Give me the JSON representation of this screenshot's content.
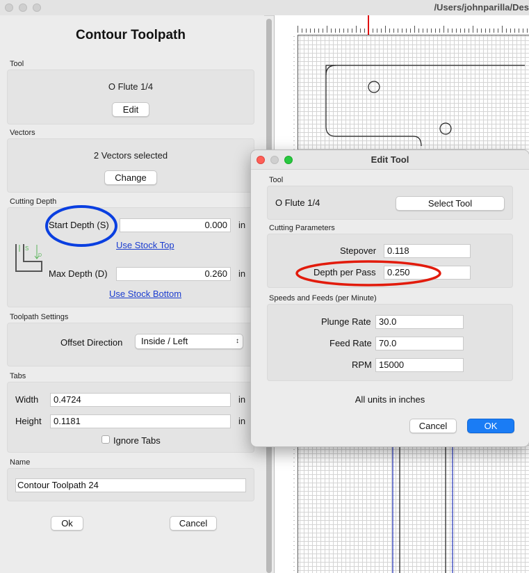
{
  "window": {
    "path": "/Users/johnparilla/Des"
  },
  "left": {
    "title": "Contour Toolpath",
    "tool": {
      "label": "Tool",
      "name": "O Flute 1/4",
      "edit_label": "Edit"
    },
    "vectors": {
      "label": "Vectors",
      "status": "2 Vectors selected",
      "change_label": "Change"
    },
    "cutting_depth": {
      "label": "Cutting Depth",
      "start_label": "Start Depth (S)",
      "start_value": "0.000",
      "start_unit": "in",
      "use_stock_top": "Use Stock Top",
      "max_label": "Max Depth (D)",
      "max_value": "0.260",
      "max_unit": "in",
      "use_stock_bottom": "Use Stock Bottom",
      "diagram_s": "S",
      "diagram_d": "D"
    },
    "toolpath_settings": {
      "label": "Toolpath Settings",
      "offset_label": "Offset Direction",
      "offset_value": "Inside / Left"
    },
    "tabs": {
      "label": "Tabs",
      "width_label": "Width",
      "width_value": "0.4724",
      "width_unit": "in",
      "height_label": "Height",
      "height_value": "0.1181",
      "height_unit": "in",
      "ignore_label": "Ignore Tabs",
      "ignore_checked": false
    },
    "name": {
      "label": "Name",
      "value": "Contour Toolpath 24"
    },
    "ok_label": "Ok",
    "cancel_label": "Cancel"
  },
  "dialog": {
    "title": "Edit Tool",
    "tool": {
      "label": "Tool",
      "name": "O Flute 1/4",
      "select_label": "Select Tool"
    },
    "cutting": {
      "label": "Cutting Parameters",
      "stepover_label": "Stepover",
      "stepover_value": "0.118",
      "depth_label": "Depth per Pass",
      "depth_value": "0.250"
    },
    "speeds": {
      "label": "Speeds and Feeds (per Minute)",
      "plunge_label": "Plunge Rate",
      "plunge_value": "30.0",
      "feed_label": "Feed Rate",
      "feed_value": "70.0",
      "rpm_label": "RPM",
      "rpm_value": "15000"
    },
    "units_note": "All units in inches",
    "cancel_label": "Cancel",
    "ok_label": "OK"
  },
  "colors": {
    "annotation_blue": "#0a3fe0",
    "annotation_red": "#e21b0c",
    "accent": "#1a7cf5"
  }
}
